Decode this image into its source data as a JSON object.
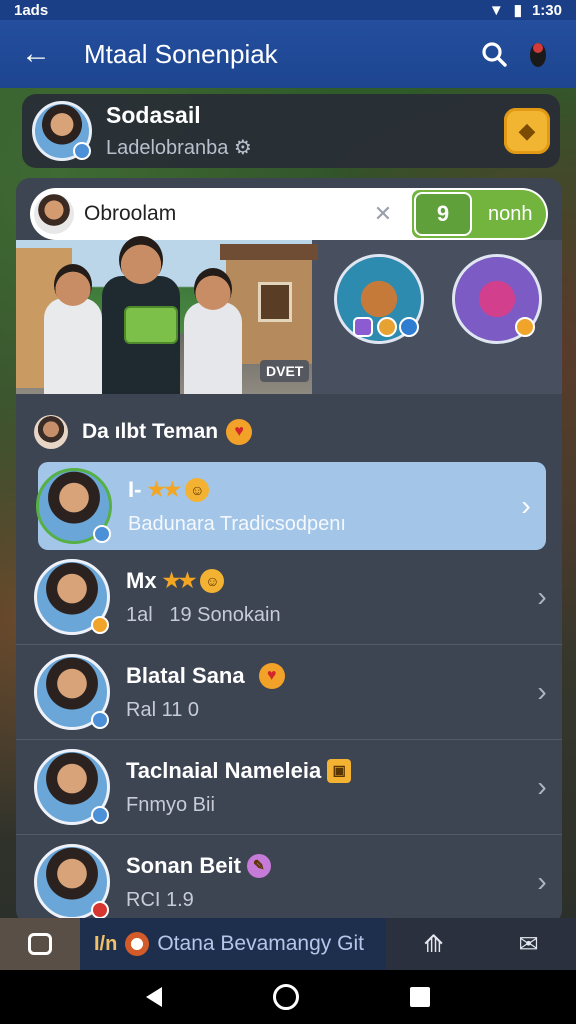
{
  "status_bar": {
    "time_left": "1ads",
    "time_right": "1:30"
  },
  "app_bar": {
    "title": "Mtaal Sonenpiak"
  },
  "profile": {
    "name": "Sodasail",
    "subtitle": "Ladelobranba"
  },
  "search": {
    "value": "Obroolam",
    "go_icon_text": "9",
    "go_label": "nonh"
  },
  "featured": {
    "photo_tag": "DVET"
  },
  "section": {
    "title": "Da ılbt Teman"
  },
  "friends": [
    {
      "name": "I-",
      "stars": "★★",
      "sub": "Badunara Tradicsodpenı",
      "selected": true
    },
    {
      "name": "Mx",
      "stars": "★★",
      "sub": "1al    19 Sonokain",
      "selected": false
    },
    {
      "name": "Blatal Sana",
      "stars": "",
      "sub": "Ral  11  0",
      "selected": false
    },
    {
      "name": "Taclnaial Nameleia",
      "stars": "",
      "sub": "Fnmyo Bii",
      "selected": false
    },
    {
      "name": "Sonan Beit",
      "stars": "",
      "sub": "RCI  1.9",
      "selected": false
    }
  ],
  "bottom_tabs": {
    "chat_prefix": "I/n",
    "chat_label": "Otana Bevamangy Git"
  },
  "colors": {
    "app_bar": "#244f9e",
    "selected_row": "#a3c6e8",
    "go_button": "#73b43f",
    "gold": "#f2b531"
  }
}
